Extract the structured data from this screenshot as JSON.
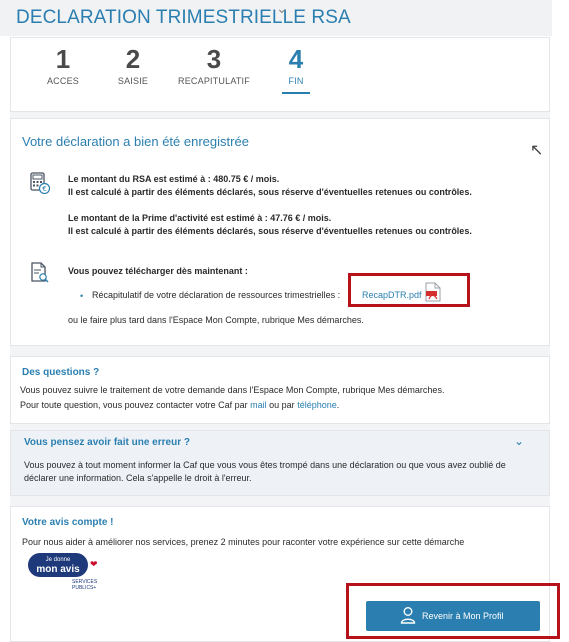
{
  "header": {
    "title": "DECLARATION TRIMESTRIELLE RSA"
  },
  "steps": [
    {
      "number": "1",
      "label": "ACCES"
    },
    {
      "number": "2",
      "label": "SAISIE"
    },
    {
      "number": "3",
      "label": "RECAPITULATIF"
    },
    {
      "number": "4",
      "label": "FIN"
    }
  ],
  "active_step": 4,
  "confirmation": {
    "title": "Votre déclaration a bien été enregistrée",
    "rsa_line1": "Le montant du RSA est estimé à : 480.75 € / mois.",
    "rsa_line2": "Il est calculé à partir des éléments déclarés, sous réserve d'éventuelles retenues ou contrôles.",
    "prime_line1": "Le montant de la Prime d'activité est estimé à : 47.76 € / mois.",
    "prime_line2": "Il est calculé à partir des éléments déclarés, sous réserve d'éventuelles retenues ou contrôles.",
    "download_intro": "Vous pouvez télécharger dès maintenant :",
    "recap_text": "Récapitulatif de votre déclaration de ressources trimestrielles :",
    "pdf_link": "RecapDTR.pdf",
    "later_text": "ou le faire plus tard dans l'Espace Mon Compte, rubrique Mes démarches."
  },
  "questions": {
    "title": "Des questions ?",
    "line1": "Vous pouvez suivre le traitement de votre demande dans l'Espace Mon Compte, rubrique Mes démarches.",
    "line2_start": "Pour toute question, vous pouvez contacter votre Caf par ",
    "mail_link": "mail",
    "line2_mid": " ou par ",
    "phone_link": "téléphone",
    "line2_end": "."
  },
  "error_section": {
    "title": "Vous pensez avoir fait une erreur ?",
    "line1": "Vous pouvez à tout moment informer la Caf que vous vous êtes trompé dans une déclaration ou que vous avez oublié de",
    "line2": "déclarer une information. Cela s'appelle le droit à l'erreur."
  },
  "feedback": {
    "title": "Votre avis compte !",
    "line": "Pour nous aider à améliorer nos services, prenez 2 minutes pour raconter votre expérience sur cette démarche",
    "badge_small": "Je donne",
    "badge_big": "mon avis",
    "badge_footer": "SERVICES PUBLICS+"
  },
  "buttons": {
    "profile": "Revenir à Mon Profil"
  },
  "colors": {
    "accent": "#2b7fb0",
    "highlight_box": "#b5121b",
    "badge_navy": "#1e3a7a"
  },
  "icons": {
    "rsa": "calculator-euro-icon",
    "download": "document-search-icon",
    "pdf": "pdf-file-icon",
    "profile": "user-icon",
    "chevron": "chevron-down-icon"
  }
}
